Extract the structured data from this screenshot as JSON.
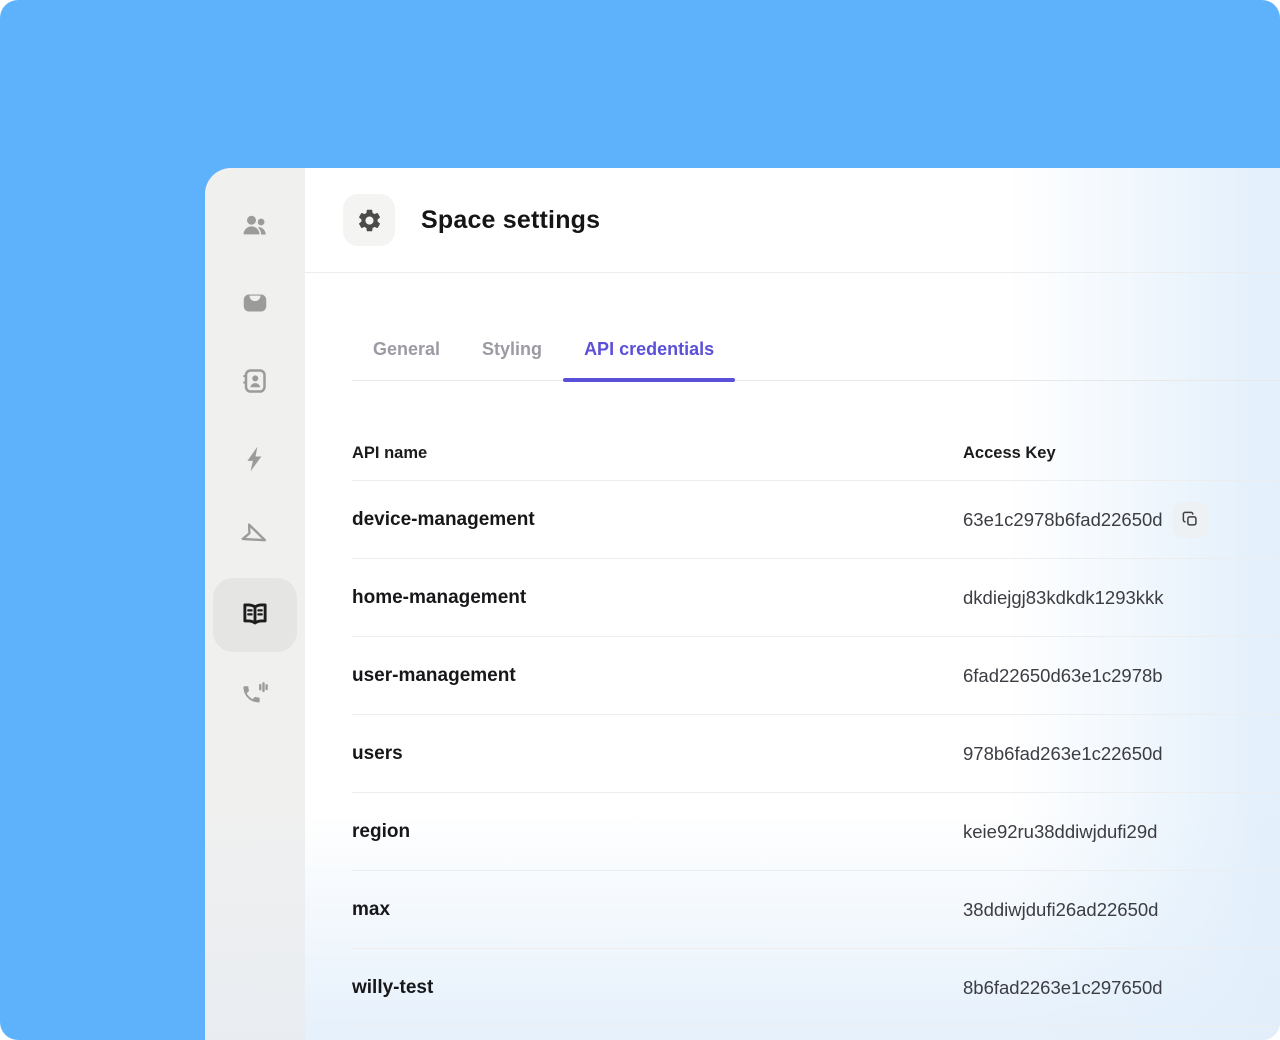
{
  "window": {
    "background_color": "#5eb1fb"
  },
  "colors": {
    "accent": "#5b50d8"
  },
  "sidebar": {
    "items": [
      {
        "id": "users",
        "icon": "users-icon",
        "active": false
      },
      {
        "id": "inbox",
        "icon": "inbox-icon",
        "active": false
      },
      {
        "id": "contact-card",
        "icon": "contact-card-icon",
        "active": false
      },
      {
        "id": "lightning",
        "icon": "lightning-icon",
        "active": false
      },
      {
        "id": "send",
        "icon": "send-icon",
        "active": false
      },
      {
        "id": "book",
        "icon": "book-icon",
        "active": true
      },
      {
        "id": "phone",
        "icon": "phone-volume-icon",
        "active": false
      }
    ]
  },
  "header": {
    "title": "Space settings",
    "icon": "gear-icon"
  },
  "tabs": [
    {
      "id": "general",
      "label": "General",
      "active": false
    },
    {
      "id": "styling",
      "label": "Styling",
      "active": false
    },
    {
      "id": "api-credentials",
      "label": "API credentials",
      "active": true
    }
  ],
  "table": {
    "columns": [
      "API name",
      "Access Key"
    ],
    "rows": [
      {
        "name": "device-management",
        "key": "63e1c2978b6fad22650d",
        "has_copy_button": true
      },
      {
        "name": "home-management",
        "key": "dkdiejgj83kdkdk1293kkk",
        "has_copy_button": false
      },
      {
        "name": "user-management",
        "key": "6fad22650d63e1c2978b",
        "has_copy_button": false
      },
      {
        "name": "users",
        "key": "978b6fad263e1c22650d",
        "has_copy_button": false
      },
      {
        "name": "region",
        "key": "keie92ru38ddiwjdufi29d",
        "has_copy_button": false
      },
      {
        "name": "max",
        "key": "38ddiwjdufi26ad22650d",
        "has_copy_button": false
      },
      {
        "name": "willy-test",
        "key": "8b6fad2263e1c297650d",
        "has_copy_button": false
      }
    ]
  }
}
